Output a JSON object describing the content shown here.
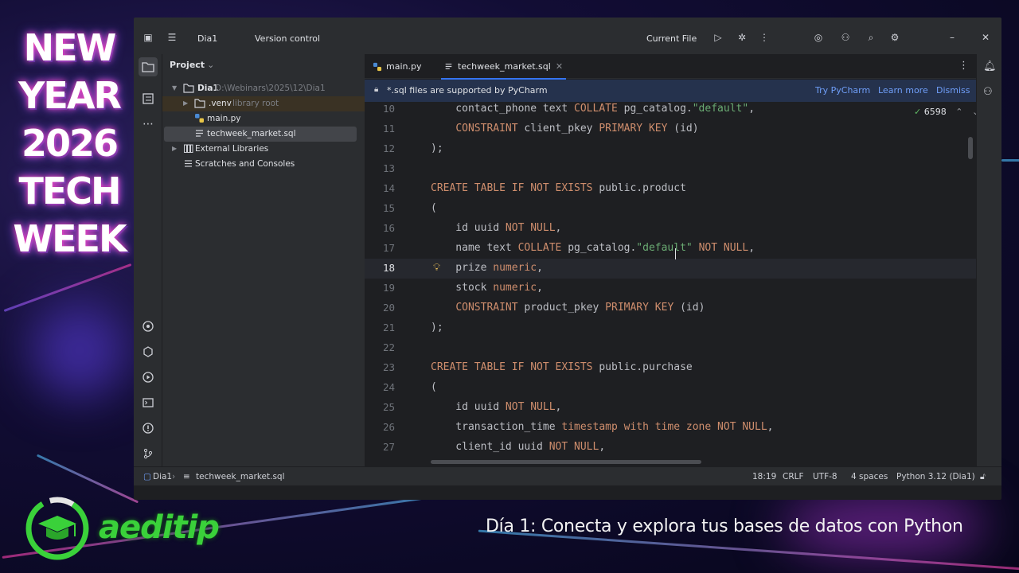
{
  "overlay": {
    "event_title_lines": [
      "NEW",
      "YEAR",
      "2026",
      "TECH",
      "WEEK"
    ],
    "brand_name": "aeditip",
    "caption": "Día 1: Conecta y explora tus bases de datos con Python"
  },
  "ide": {
    "titlebar": {
      "project_name": "Dia1",
      "vcs_label": "Version control",
      "run_config": "Current File"
    },
    "toolstrip_icons": [
      "folder-icon",
      "structure-icon",
      "more-icon",
      "python-packages-icon",
      "services-icon",
      "run-icon",
      "terminal-icon",
      "problems-icon",
      "git-icon"
    ],
    "project_panel": {
      "title": "Project",
      "tree": [
        {
          "label": "Dia1",
          "detail": "D:\\Webinars\\2025\\12\\Dia1",
          "icon": "folder-icon",
          "expanded": true
        },
        {
          "label": ".venv",
          "detail": "library root",
          "icon": "folder-icon",
          "expanded": false
        },
        {
          "label": "main.py",
          "detail": "",
          "icon": "python-file-icon"
        },
        {
          "label": "techweek_market.sql",
          "detail": "",
          "icon": "sql-file-icon"
        },
        {
          "label": "External Libraries",
          "detail": "",
          "icon": "library-icon",
          "expanded": false
        },
        {
          "label": "Scratches and Consoles",
          "detail": "",
          "icon": "scratches-icon"
        }
      ]
    },
    "tabs": [
      {
        "label": "main.py",
        "active": false
      },
      {
        "label": "techweek_market.sql",
        "active": true
      }
    ],
    "notification": {
      "message": "*.sql files are supported by PyCharm",
      "try_label": "Try PyCharm",
      "learn_label": "Learn more",
      "dismiss_label": "Dismiss"
    },
    "inspection": {
      "count": "6598"
    },
    "current_line": 18,
    "code_lines": [
      {
        "n": "10",
        "tokens": [
          [
            "    contact_phone text ",
            ""
          ],
          [
            "COLLATE",
            "kw"
          ],
          [
            " pg_catalog.",
            ""
          ],
          [
            "\"default\"",
            "str"
          ],
          [
            ",",
            ""
          ]
        ]
      },
      {
        "n": "11",
        "tokens": [
          [
            "    ",
            ""
          ],
          [
            "CONSTRAINT",
            "kw"
          ],
          [
            " client_pkey ",
            ""
          ],
          [
            "PRIMARY KEY",
            "kw"
          ],
          [
            " (id)",
            ""
          ]
        ]
      },
      {
        "n": "12",
        "tokens": [
          [
            ");",
            ""
          ]
        ]
      },
      {
        "n": "13",
        "tokens": []
      },
      {
        "n": "14",
        "tokens": [
          [
            "CREATE TABLE IF NOT EXISTS",
            "kw"
          ],
          [
            " public.product",
            ""
          ]
        ]
      },
      {
        "n": "15",
        "tokens": [
          [
            "(",
            ""
          ]
        ]
      },
      {
        "n": "16",
        "tokens": [
          [
            "    id uuid ",
            ""
          ],
          [
            "NOT NULL",
            "kw"
          ],
          [
            ",",
            ""
          ]
        ]
      },
      {
        "n": "17",
        "tokens": [
          [
            "    name text ",
            ""
          ],
          [
            "COLLATE",
            "kw"
          ],
          [
            " pg_catalog.",
            ""
          ],
          [
            "\"default\"",
            "str"
          ],
          [
            " ",
            ""
          ],
          [
            "NOT NULL",
            "kw"
          ],
          [
            ",",
            ""
          ]
        ]
      },
      {
        "n": "18",
        "tokens": [
          [
            "    prize ",
            ""
          ],
          [
            "numeric",
            "ty"
          ],
          [
            ",",
            ""
          ]
        ]
      },
      {
        "n": "19",
        "tokens": [
          [
            "    stock ",
            ""
          ],
          [
            "numeric",
            "ty"
          ],
          [
            ",",
            ""
          ]
        ]
      },
      {
        "n": "20",
        "tokens": [
          [
            "    ",
            ""
          ],
          [
            "CONSTRAINT",
            "kw"
          ],
          [
            " product_pkey ",
            ""
          ],
          [
            "PRIMARY KEY",
            "kw"
          ],
          [
            " (id)",
            ""
          ]
        ]
      },
      {
        "n": "21",
        "tokens": [
          [
            ");",
            ""
          ]
        ]
      },
      {
        "n": "22",
        "tokens": []
      },
      {
        "n": "23",
        "tokens": [
          [
            "CREATE TABLE IF NOT EXISTS",
            "kw"
          ],
          [
            " public.purchase",
            ""
          ]
        ]
      },
      {
        "n": "24",
        "tokens": [
          [
            "(",
            ""
          ]
        ]
      },
      {
        "n": "25",
        "tokens": [
          [
            "    id uuid ",
            ""
          ],
          [
            "NOT NULL",
            "kw"
          ],
          [
            ",",
            ""
          ]
        ]
      },
      {
        "n": "26",
        "tokens": [
          [
            "    transaction_time ",
            ""
          ],
          [
            "timestamp with time zone",
            "ty"
          ],
          [
            " ",
            ""
          ],
          [
            "NOT NULL",
            "kw"
          ],
          [
            ",",
            ""
          ]
        ]
      },
      {
        "n": "27",
        "tokens": [
          [
            "    client_id uuid ",
            ""
          ],
          [
            "NOT NULL",
            "kw"
          ],
          [
            ",",
            ""
          ]
        ]
      }
    ],
    "statusbar": {
      "breadcrumb_project": "Dia1",
      "breadcrumb_file": "techweek_market.sql",
      "position": "18:19",
      "line_separator": "CRLF",
      "encoding": "UTF-8",
      "indent": "4 spaces",
      "interpreter": "Python 3.12 (Dia1)"
    }
  },
  "colors": {
    "keyword": "#cf8e6d",
    "string": "#6aab73",
    "text": "#bcbec4",
    "brand_green": "#3ad13a",
    "accent_blue": "#3574f0"
  }
}
